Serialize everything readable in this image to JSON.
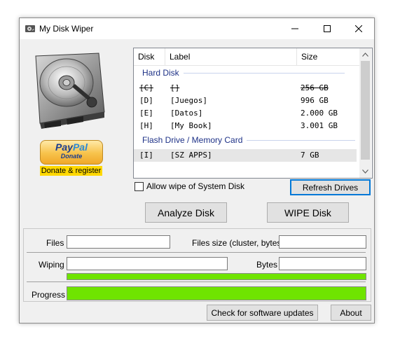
{
  "window": {
    "title": "My Disk Wiper",
    "icon": "disk-wiper-icon",
    "controls": [
      "minimize-icon",
      "maximize-icon",
      "close-icon"
    ]
  },
  "donate": {
    "paypal_logo_pay": "Pay",
    "paypal_logo_pal": "Pal",
    "paypal_sub": "Donate",
    "register_label": "Donate & register"
  },
  "drive_list": {
    "columns": {
      "disk": "Disk",
      "label": "Label",
      "size": "Size"
    },
    "groups": [
      {
        "name": "Hard Disk",
        "rows": [
          {
            "disk": "[C]",
            "label": "[]",
            "size": "256 GB",
            "disabled": true
          },
          {
            "disk": "[D]",
            "label": "[Juegos]",
            "size": "996 GB"
          },
          {
            "disk": "[E]",
            "label": "[Datos]",
            "size": "2.000 GB"
          },
          {
            "disk": "[H]",
            "label": "[My Book]",
            "size": "3.001 GB"
          }
        ]
      },
      {
        "name": "Flash Drive / Memory Card",
        "rows": [
          {
            "disk": "[I]",
            "label": "[SZ APPS]",
            "size": "7 GB",
            "selected": true
          }
        ]
      }
    ]
  },
  "options": {
    "allow_system_wipe_label": "Allow wipe of System Disk",
    "allow_system_wipe_checked": false
  },
  "buttons": {
    "refresh": "Refresh Drives",
    "analyze": "Analyze Disk",
    "wipe": "WIPE Disk",
    "updates": "Check for software updates",
    "about": "About"
  },
  "status": {
    "files_label": "Files",
    "files_value": "",
    "files_size_label": "Files size (cluster, bytes)",
    "files_size_value": "",
    "wiping_label": "Wiping",
    "wiping_value": "",
    "bytes_label": "Bytes",
    "bytes_value": "",
    "wiping_progress": 1.0,
    "progress_label": "Progress",
    "overall_progress": 1.0
  },
  "colors": {
    "progress_fill": "#6fe400",
    "group_header": "#1e3287",
    "focus_border": "#0078d7",
    "donate_highlight": "#ffd800"
  }
}
